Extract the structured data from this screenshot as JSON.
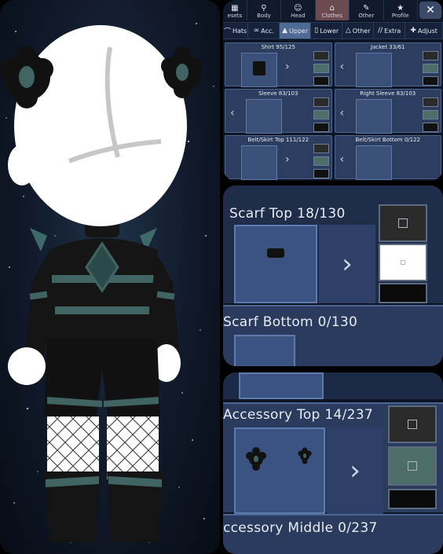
{
  "top_tabs": [
    {
      "label": "esets",
      "icon": "presets-icon"
    },
    {
      "label": "Body",
      "icon": "body-icon"
    },
    {
      "label": "Head",
      "icon": "head-icon"
    },
    {
      "label": "Clothes",
      "icon": "clothes-icon"
    },
    {
      "label": "Other",
      "icon": "other-icon"
    },
    {
      "label": "Profile",
      "icon": "profile-icon"
    }
  ],
  "close_label": "✕",
  "sub_tabs": [
    {
      "label": "Hats",
      "icon": "hat-icon"
    },
    {
      "label": "Acc.",
      "icon": "glasses-icon"
    },
    {
      "label": "Upper",
      "icon": "upper-icon"
    },
    {
      "label": "Lower",
      "icon": "lower-icon"
    },
    {
      "label": "Other",
      "icon": "other-icon"
    },
    {
      "label": "Extra",
      "icon": "extra-icon"
    },
    {
      "label": "Adjust",
      "icon": "adjust-icon"
    }
  ],
  "slots": [
    {
      "label": "Shirt 95/125"
    },
    {
      "label": "Jacket 33/61"
    },
    {
      "label": "Sleeve 83/103"
    },
    {
      "label": "Right Sleeve 83/103"
    },
    {
      "label": "Belt/Skirt Top 111/122"
    },
    {
      "label": "Belt/Skirt Bottom 0/122"
    }
  ],
  "scarf": {
    "top_label": "Scarf Top 18/130",
    "bottom_label": "Scarf Bottom 0/130"
  },
  "accessory": {
    "top_label": "Accessory Top 14/237",
    "middle_label": "ccessory Middle 0/237"
  },
  "colors": {
    "accent": "#4f6a93",
    "panel": "#2b3b5d",
    "teal": "#4d6d68"
  }
}
